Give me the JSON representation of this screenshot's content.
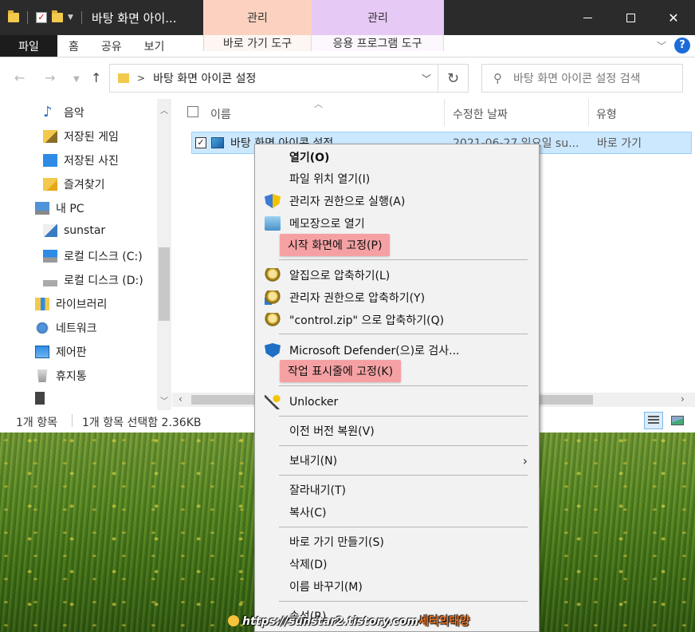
{
  "window": {
    "title": "바탕 화면 아이...",
    "context_tab_shortcut": "관리",
    "context_tab_app": "관리"
  },
  "ribbon": {
    "tabs": [
      "파일",
      "홈",
      "공유",
      "보기"
    ],
    "shortcut_tools": "바로 가기 도구",
    "app_tools": "응용 프로그램 도구"
  },
  "address": {
    "path": "바탕 화면 아이콘 설정",
    "search_placeholder": "바탕 화면 아이콘 설정 검색"
  },
  "nav": {
    "items": [
      {
        "label": "음악",
        "icon": "music-icon"
      },
      {
        "label": "저장된 게임",
        "icon": "saved-games-icon"
      },
      {
        "label": "저장된 사진",
        "icon": "saved-pictures-icon"
      },
      {
        "label": "즐겨찾기",
        "icon": "favorites-icon"
      },
      {
        "label": "내 PC",
        "icon": "this-pc-icon"
      },
      {
        "label": "sunstar",
        "icon": "user-folder-icon"
      },
      {
        "label": "로컬 디스크 (C:)",
        "icon": "windows-drive-icon"
      },
      {
        "label": "로컬 디스크 (D:)",
        "icon": "drive-icon"
      },
      {
        "label": "라이브러리",
        "icon": "library-icon"
      },
      {
        "label": "네트워크",
        "icon": "network-icon"
      },
      {
        "label": "제어판",
        "icon": "control-panel-icon"
      },
      {
        "label": "휴지통",
        "icon": "recycle-bin-icon"
      }
    ]
  },
  "filelist": {
    "columns": [
      "이름",
      "수정한 날짜",
      "유형"
    ],
    "row": {
      "name": "바탕 화면 아이콘 설정",
      "date": "2021-06-27 일요일 su...",
      "type": "바로 가기"
    }
  },
  "status": {
    "count": "1개 항목",
    "selection": "1개 항목 선택함 2.36KB"
  },
  "context_menu": {
    "items": [
      {
        "label": "열기(O)"
      },
      {
        "label": "파일 위치 열기(I)"
      },
      {
        "label": "관리자 권한으로 실행(A)",
        "icon": "uac-shield-icon"
      },
      {
        "label": "메모장으로 열기",
        "icon": "notepad-icon"
      },
      {
        "label": "시작 화면에 고정(P)",
        "highlighted": true
      },
      {
        "label": "알집으로 압축하기(L)",
        "icon": "alzip-icon"
      },
      {
        "label": "관리자 권한으로 압축하기(Y)",
        "icon": "alzip-admin-icon"
      },
      {
        "label": "\"control.zip\" 으로 압축하기(Q)",
        "icon": "alzip-icon"
      },
      {
        "label": "Microsoft Defender(으)로 검사...",
        "icon": "defender-icon"
      },
      {
        "label": "작업 표시줄에 고정(K)",
        "highlighted": true
      },
      {
        "label": "Unlocker",
        "icon": "unlocker-icon"
      },
      {
        "label": "이전 버전 복원(V)"
      },
      {
        "label": "보내기(N)",
        "submenu": true
      },
      {
        "label": "잘라내기(T)"
      },
      {
        "label": "복사(C)"
      },
      {
        "label": "바로 가기 만들기(S)"
      },
      {
        "label": "삭제(D)"
      },
      {
        "label": "이름 바꾸기(M)"
      },
      {
        "label": "속성(R)"
      }
    ],
    "highlight_color": "#f5a1a4"
  },
  "watermark": {
    "url": "https://sunstar2.tistory.com",
    "brand": "세터의태양"
  }
}
